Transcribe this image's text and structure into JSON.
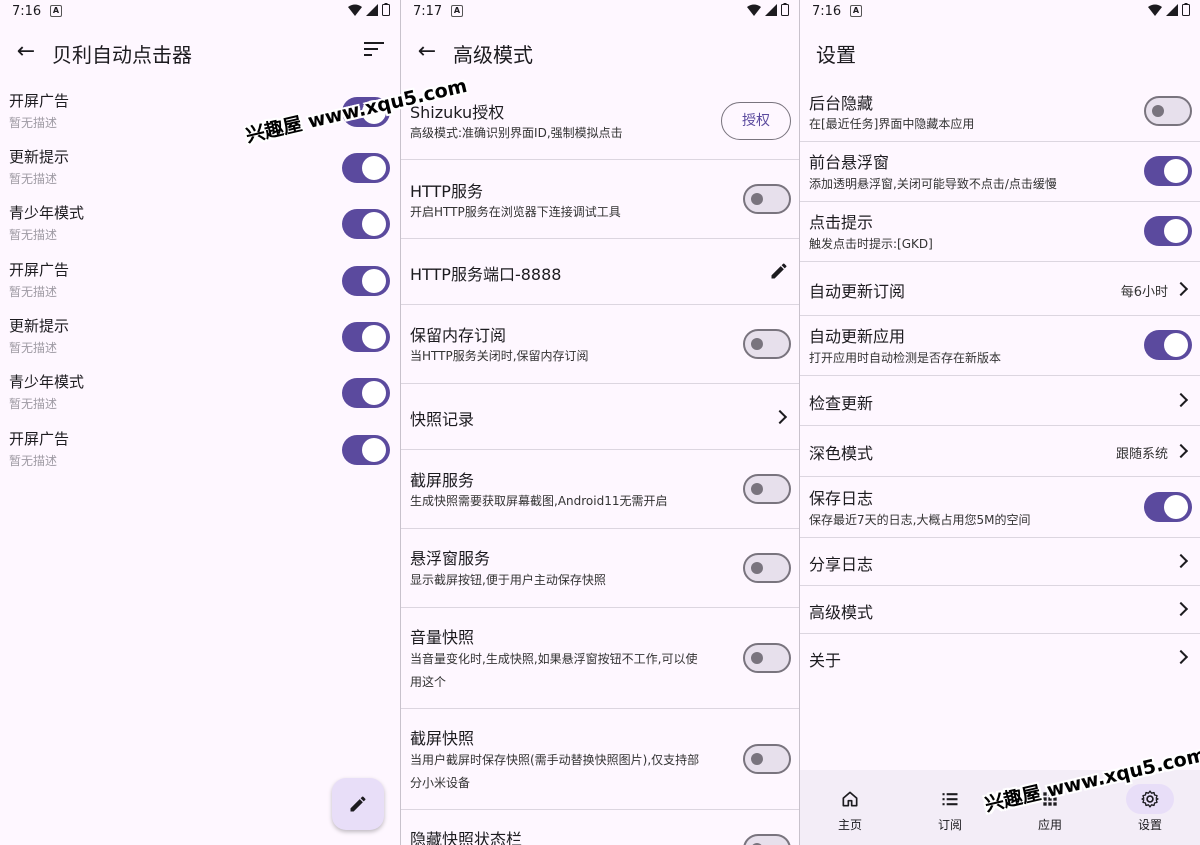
{
  "screen1": {
    "status_time": "7:16",
    "title": "贝利自动点击器",
    "rules": [
      {
        "title": "开屏广告",
        "desc": "暂无描述",
        "on": true
      },
      {
        "title": "更新提示",
        "desc": "暂无描述",
        "on": true
      },
      {
        "title": "青少年模式",
        "desc": "暂无描述",
        "on": true
      },
      {
        "title": "开屏广告",
        "desc": "暂无描述",
        "on": true
      },
      {
        "title": "更新提示",
        "desc": "暂无描述",
        "on": true
      },
      {
        "title": "青少年模式",
        "desc": "暂无描述",
        "on": true
      },
      {
        "title": "开屏广告",
        "desc": "暂无描述",
        "on": true
      }
    ]
  },
  "screen2": {
    "status_time": "7:17",
    "title": "高级模式",
    "shizuku": {
      "title": "Shizuku授权",
      "desc": "高级模式:准确识别界面ID,强制模拟点击",
      "button": "授权"
    },
    "http": {
      "title": "HTTP服务",
      "desc": "开启HTTP服务在浏览器下连接调试工具",
      "on": false
    },
    "port": {
      "title": "HTTP服务端口-8888"
    },
    "keep": {
      "title": "保留内存订阅",
      "desc": "当HTTP服务关闭时,保留内存订阅",
      "on": false
    },
    "snap": {
      "title": "快照记录"
    },
    "screenshot": {
      "title": "截屏服务",
      "desc": "生成快照需要获取屏幕截图,Android11无需开启",
      "on": false
    },
    "float": {
      "title": "悬浮窗服务",
      "desc": "显示截屏按钮,便于用户主动保存快照",
      "on": false
    },
    "volume": {
      "title": "音量快照",
      "desc1": "当音量变化时,生成快照,如果悬浮窗按钮不工作,可以使",
      "desc2": "用这个",
      "on": false
    },
    "capture": {
      "title": "截屏快照",
      "desc1": "当用户截屏时保存快照(需手动替换快照图片),仅支持部",
      "desc2": "分小米设备",
      "on": false
    },
    "hide": {
      "title": "隐藏快照状态栏"
    }
  },
  "screen3": {
    "status_time": "7:16",
    "title": "设置",
    "bg_hide": {
      "title": "后台隐藏",
      "desc": "在[最近任务]界面中隐藏本应用",
      "on": false
    },
    "fg_float": {
      "title": "前台悬浮窗",
      "desc": "添加透明悬浮窗,关闭可能导致不点击/点击缓慢",
      "on": true
    },
    "click_tip": {
      "title": "点击提示",
      "desc": "触发点击时提示:[GKD]",
      "on": true
    },
    "auto_sub": {
      "title": "自动更新订阅",
      "value": "每6小时"
    },
    "auto_app": {
      "title": "自动更新应用",
      "desc": "打开应用时自动检测是否存在新版本",
      "on": true
    },
    "check_update": {
      "title": "检查更新"
    },
    "dark": {
      "title": "深色模式",
      "value": "跟随系统"
    },
    "save_log": {
      "title": "保存日志",
      "desc": "保存最近7天的日志,大概占用您5M的空间",
      "on": true
    },
    "share_log": {
      "title": "分享日志"
    },
    "advanced": {
      "title": "高级模式"
    },
    "about": {
      "title": "关于"
    },
    "nav": {
      "home": "主页",
      "sub": "订阅",
      "apps": "应用",
      "settings": "设置"
    }
  },
  "watermark": "兴趣屋 www.xqu5.com",
  "colors": {
    "accent": "#5b4a9e",
    "background": "#fef7ff",
    "toggle_off": "#e7e0ec"
  }
}
